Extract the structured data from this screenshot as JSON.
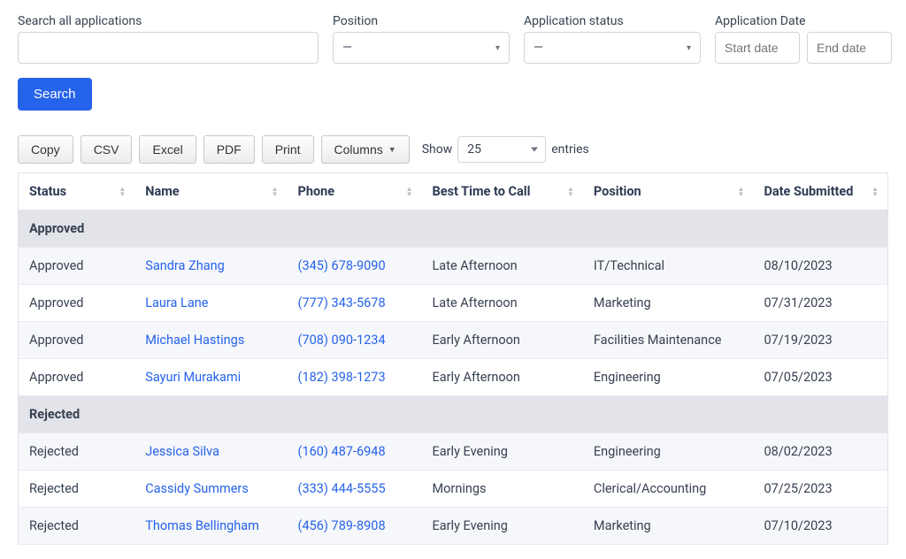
{
  "filters": {
    "search_label": "Search all applications",
    "position_label": "Position",
    "position_value": "—",
    "status_label": "Application status",
    "status_value": "—",
    "date_label": "Application Date",
    "start_placeholder": "Start date",
    "end_placeholder": "End date"
  },
  "buttons": {
    "search": "Search",
    "copy": "Copy",
    "csv": "CSV",
    "excel": "Excel",
    "pdf": "PDF",
    "print": "Print",
    "columns": "Columns"
  },
  "table": {
    "show_label": "Show",
    "entries_label": "entries",
    "entries_value": "25",
    "columns": {
      "status": "Status",
      "name": "Name",
      "phone": "Phone",
      "best_time": "Best Time to Call",
      "position": "Position",
      "date": "Date Submitted"
    },
    "groups": [
      {
        "label": "Approved",
        "rows": [
          {
            "status": "Approved",
            "name": "Sandra Zhang",
            "phone": "(345) 678-9090",
            "best_time": "Late Afternoon",
            "position": "IT/Technical",
            "date": "08/10/2023"
          },
          {
            "status": "Approved",
            "name": "Laura Lane",
            "phone": "(777) 343-5678",
            "best_time": "Late Afternoon",
            "position": "Marketing",
            "date": "07/31/2023"
          },
          {
            "status": "Approved",
            "name": "Michael Hastings",
            "phone": "(708) 090-1234",
            "best_time": "Early Afternoon",
            "position": "Facilities Maintenance",
            "date": "07/19/2023"
          },
          {
            "status": "Approved",
            "name": "Sayuri Murakami",
            "phone": "(182) 398-1273",
            "best_time": "Early Afternoon",
            "position": "Engineering",
            "date": "07/05/2023"
          }
        ]
      },
      {
        "label": "Rejected",
        "rows": [
          {
            "status": "Rejected",
            "name": "Jessica Silva",
            "phone": "(160) 487-6948",
            "best_time": "Early Evening",
            "position": "Engineering",
            "date": "08/02/2023"
          },
          {
            "status": "Rejected",
            "name": "Cassidy Summers",
            "phone": "(333) 444-5555",
            "best_time": "Mornings",
            "position": "Clerical/Accounting",
            "date": "07/25/2023"
          },
          {
            "status": "Rejected",
            "name": "Thomas Bellingham",
            "phone": "(456) 789-8908",
            "best_time": "Early Evening",
            "position": "Marketing",
            "date": "07/10/2023"
          }
        ]
      }
    ]
  }
}
